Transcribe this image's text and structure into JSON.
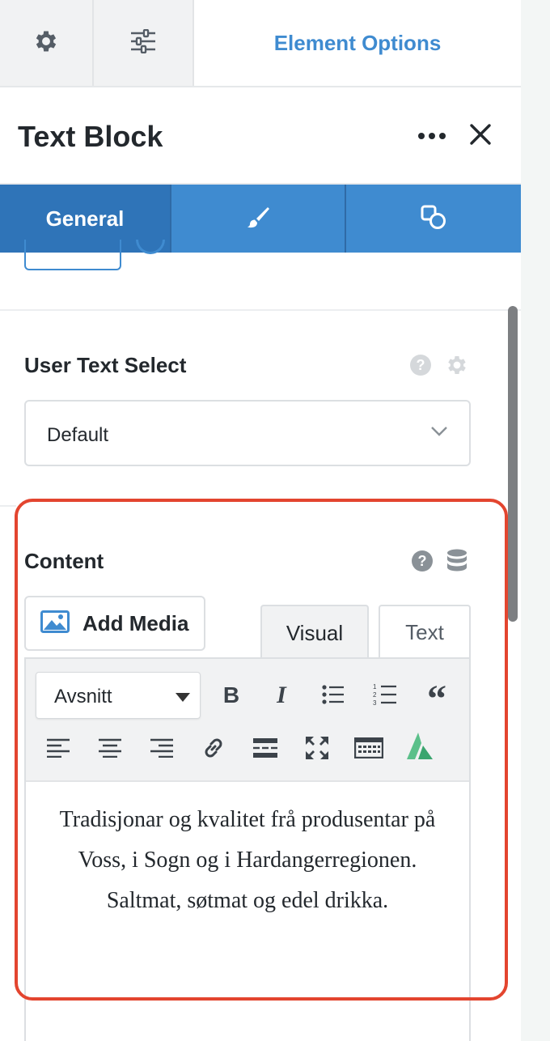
{
  "top_tabs": {
    "element_options_label": "Element Options"
  },
  "header": {
    "title": "Text Block"
  },
  "blue_tabs": {
    "general_label": "General"
  },
  "user_text_select": {
    "label": "User Text Select",
    "value": "Default"
  },
  "content": {
    "label": "Content",
    "add_media_label": "Add Media",
    "mode_visual": "Visual",
    "mode_text": "Text",
    "format_value": "Avsnitt",
    "paragraphs": [
      "Tradisjonar og kvalitet frå produsentar på Voss, i Sogn og i Hardangerregionen.",
      "Saltmat, søtmat og edel drikka."
    ]
  },
  "colors": {
    "accent_blue": "#3f8bd0",
    "active_tab_blue": "#2f74b8",
    "highlight_red": "#e3452f"
  }
}
